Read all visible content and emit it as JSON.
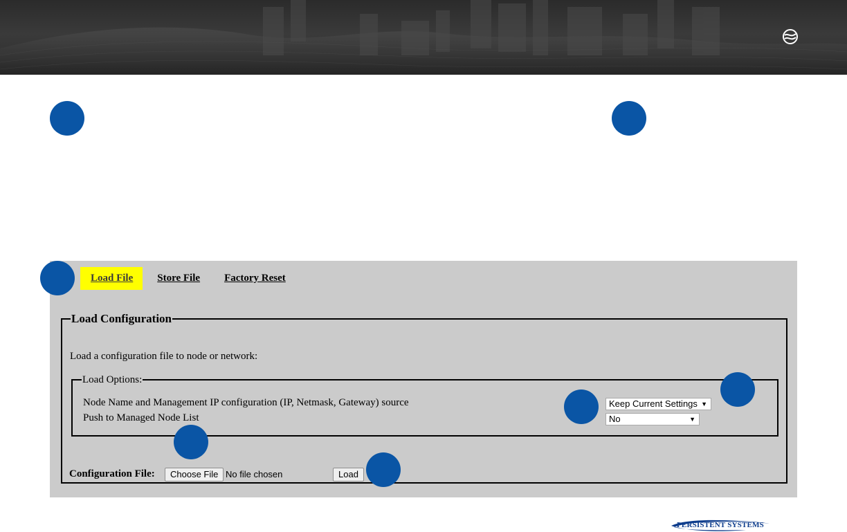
{
  "tabs": [
    {
      "label": "Load File",
      "active": true
    },
    {
      "label": "Store File",
      "active": false
    },
    {
      "label": "Factory Reset",
      "active": false
    }
  ],
  "load_configuration": {
    "legend": "Load Configuration",
    "intro": "Load a configuration file to node or network:",
    "options": {
      "legend": "Load Options:",
      "rows": [
        {
          "label": "Node Name and Management IP configuration (IP, Netmask, Gateway) source",
          "selected": "Keep Current Settings"
        },
        {
          "label": "Push to Managed Node List",
          "selected": "No"
        }
      ]
    },
    "file_label": "Configuration File:",
    "choose_button": "Choose File",
    "file_status": "No file chosen",
    "load_button": "Load"
  },
  "footer": {
    "logo_text": "PERSISTENT SYSTEMS"
  },
  "colors": {
    "header_bg": "#333333",
    "marker": "#0a55a5",
    "panel_bg": "#cbcbcb",
    "active_tab": "#ffff00",
    "logo_blue": "#0d3c8c"
  },
  "icons": {
    "header_brand": "wave-globe-icon",
    "select_caret": "caret-down-icon"
  }
}
